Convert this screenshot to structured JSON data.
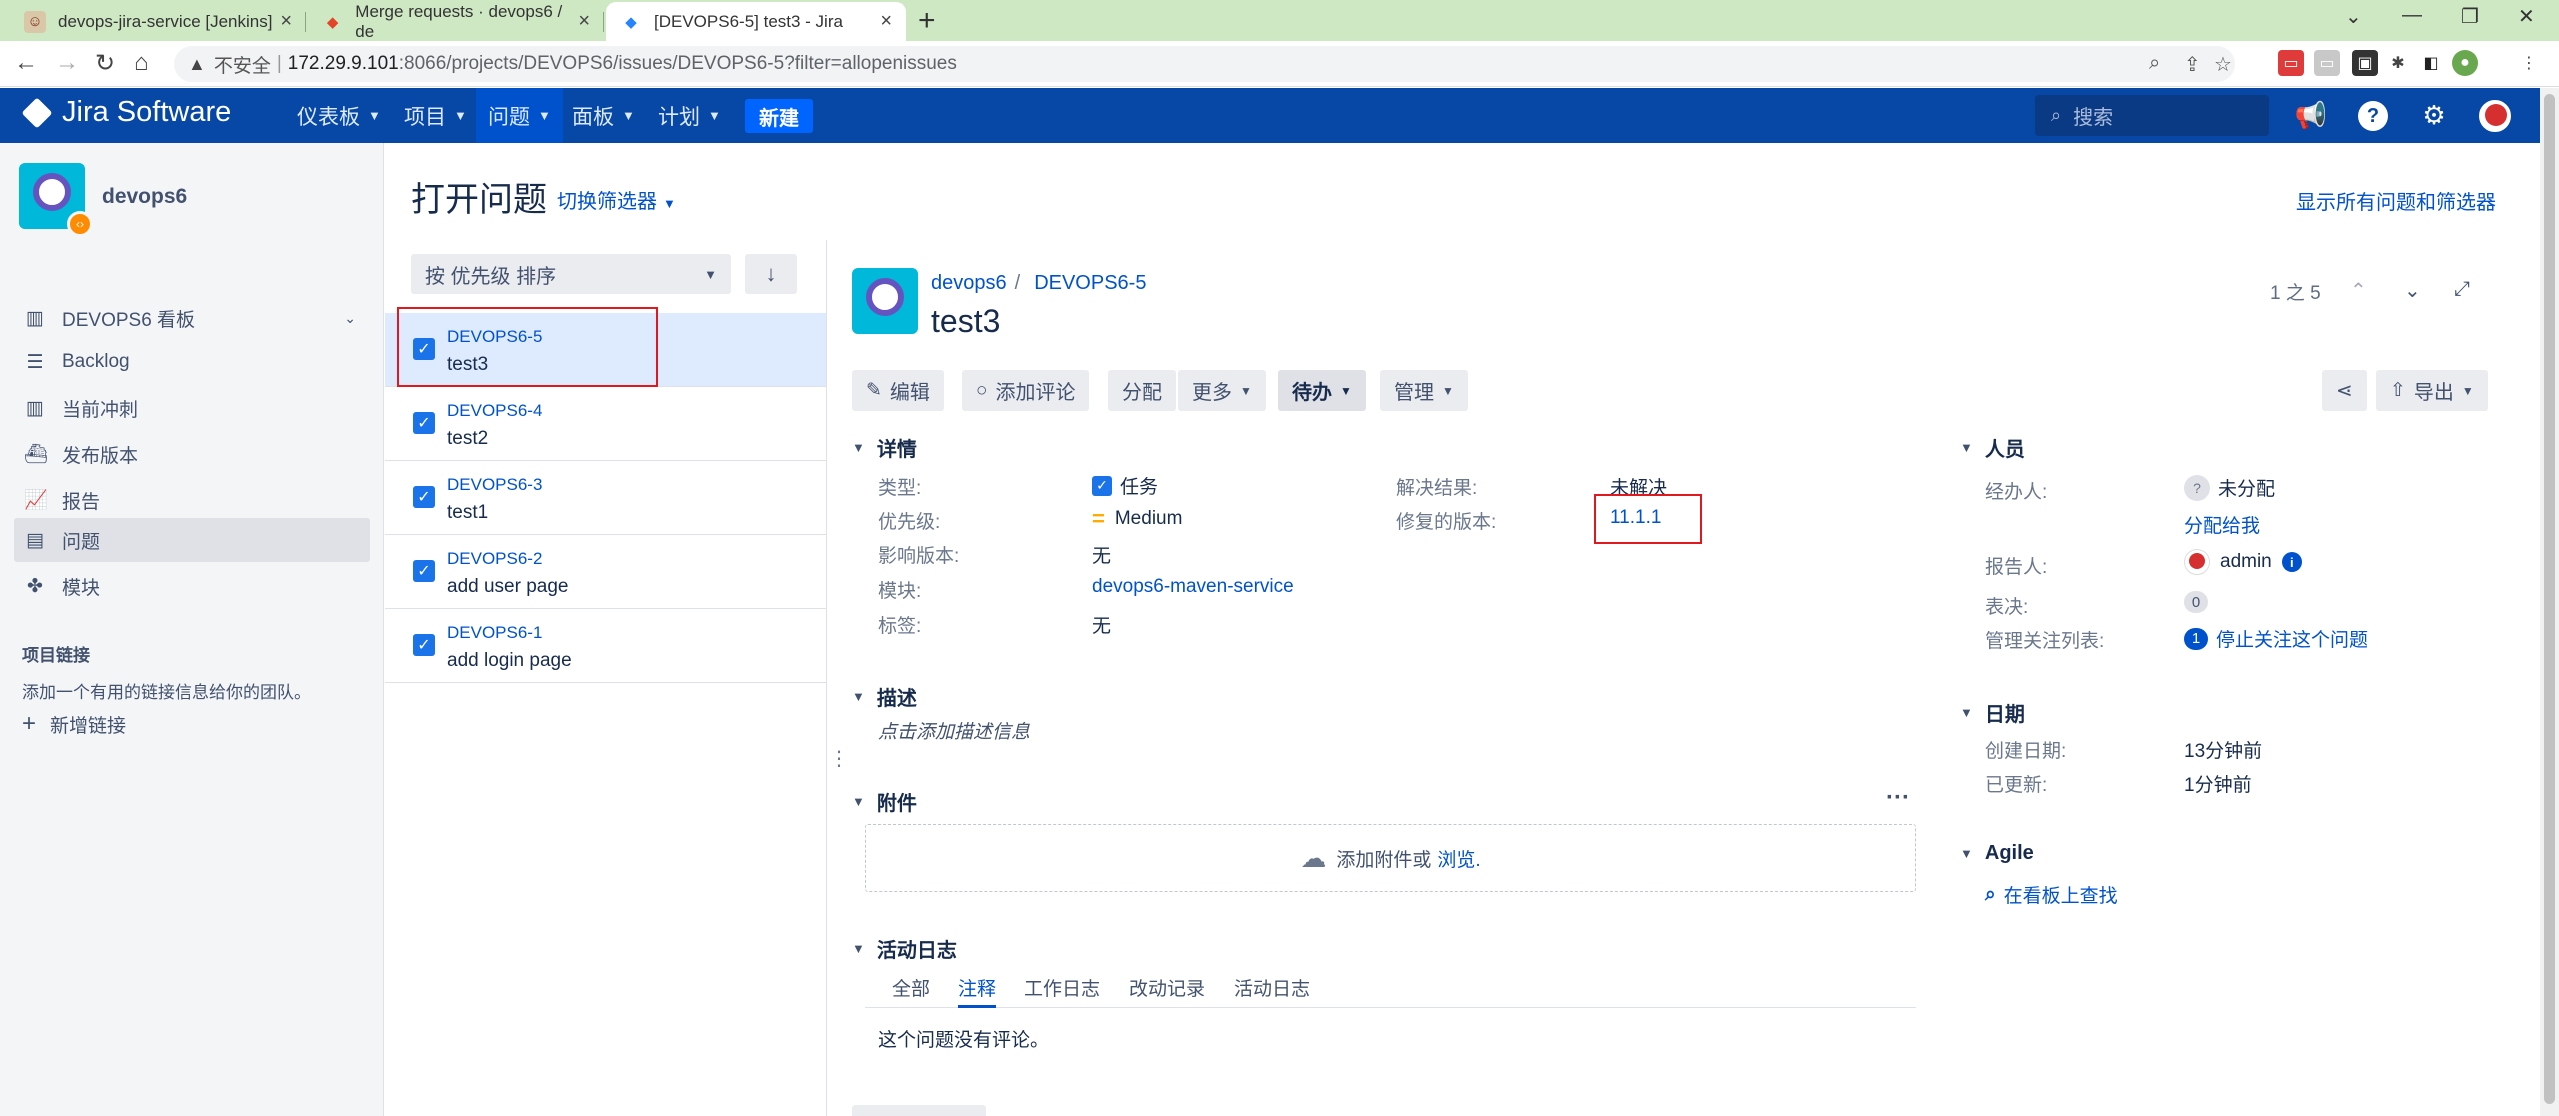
{
  "browser": {
    "tabs": [
      {
        "title": "devops-jira-service [Jenkins]",
        "icon": "jenkins-icon"
      },
      {
        "title": "Merge requests · devops6 / de",
        "icon": "gitlab-icon"
      },
      {
        "title": "[DEVOPS6-5] test3 - Jira",
        "icon": "jira-icon"
      }
    ],
    "close": "×",
    "new_tab": "+",
    "insecure": "不安全",
    "url_host": "172.29.9.101",
    "url_path": ":8066/projects/DEVOPS6/issues/DEVOPS6-5?filter=allopenissues"
  },
  "header": {
    "logo": "Jira Software",
    "nav": [
      "仪表板",
      "项目",
      "问题",
      "面板",
      "计划"
    ],
    "create": "新建",
    "search_placeholder": "搜索"
  },
  "sidebar": {
    "project": "devops6",
    "items": [
      {
        "label": "DEVOPS6 看板",
        "icon": "board-icon"
      },
      {
        "label": "Backlog",
        "icon": "backlog-icon"
      },
      {
        "label": "当前冲刺",
        "icon": "sprint-icon"
      },
      {
        "label": "发布版本",
        "icon": "release-icon"
      },
      {
        "label": "报告",
        "icon": "report-icon"
      },
      {
        "label": "问题",
        "icon": "issues-icon"
      },
      {
        "label": "模块",
        "icon": "components-icon"
      }
    ],
    "links_heading": "项目链接",
    "links_text": "添加一个有用的链接信息给你的团队。",
    "add_link": "新增链接"
  },
  "page": {
    "title": "打开问题",
    "switch_filter": "切换筛选器",
    "show_all": "显示所有问题和筛选器",
    "sort": "按 优先级 排序"
  },
  "issues": [
    {
      "key": "DEVOPS6-5",
      "summary": "test3"
    },
    {
      "key": "DEVOPS6-4",
      "summary": "test2"
    },
    {
      "key": "DEVOPS6-3",
      "summary": "test1"
    },
    {
      "key": "DEVOPS6-2",
      "summary": "add user page"
    },
    {
      "key": "DEVOPS6-1",
      "summary": "add login page"
    }
  ],
  "detail": {
    "crumb_project": "devops6",
    "crumb_key": "DEVOPS6-5",
    "title": "test3",
    "pager": "1 之 5",
    "toolbar": {
      "edit": "编辑",
      "comment": "添加评论",
      "assign": "分配",
      "more": "更多",
      "status": "待办",
      "admin": "管理",
      "export": "导出"
    },
    "details_heading": "详情",
    "fields": {
      "type_label": "类型:",
      "type_value": "任务",
      "priority_label": "优先级:",
      "priority_value": "Medium",
      "affects_label": "影响版本:",
      "affects_value": "无",
      "component_label": "模块:",
      "component_value": "devops6-maven-service",
      "labels_label": "标签:",
      "labels_value": "无",
      "resolution_label": "解决结果:",
      "resolution_value": "未解决",
      "fix_label": "修复的版本:",
      "fix_value": "11.1.1"
    },
    "description_heading": "描述",
    "description_placeholder": "点击添加描述信息",
    "attachments_heading": "附件",
    "attach_text": "添加附件或",
    "attach_browse": "浏览.",
    "activity_heading": "活动日志",
    "activity_tabs": [
      "全部",
      "注释",
      "工作日志",
      "改动记录",
      "活动日志"
    ],
    "no_comments": "这个问题没有评论。"
  },
  "people": {
    "heading": "人员",
    "assignee_label": "经办人:",
    "assignee_value": "未分配",
    "assign_to_me": "分配给我",
    "reporter_label": "报告人:",
    "reporter_value": "admin",
    "votes_label": "表决:",
    "votes_value": "0",
    "watchers_label": "管理关注列表:",
    "watchers_count": "1",
    "watchers_action": "停止关注这个问题"
  },
  "dates": {
    "heading": "日期",
    "created_label": "创建日期:",
    "created_value": "13分钟前",
    "updated_label": "已更新:",
    "updated_value": "1分钟前"
  },
  "agile": {
    "heading": "Agile",
    "link": "在看板上查找"
  }
}
